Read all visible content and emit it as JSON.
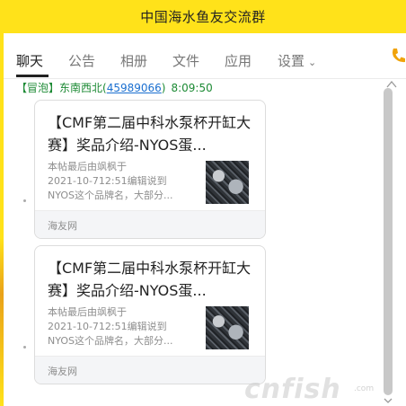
{
  "window": {
    "title": "中国海水鱼友交流群"
  },
  "tabs": [
    {
      "label": "聊天",
      "active": true
    },
    {
      "label": "公告",
      "active": false
    },
    {
      "label": "相册",
      "active": false
    },
    {
      "label": "文件",
      "active": false
    },
    {
      "label": "应用",
      "active": false
    },
    {
      "label": "设置",
      "active": false
    }
  ],
  "colors": {
    "title_bar": "#ffe21a",
    "sender": "#1c8a34",
    "qq_link": "#1a6fd0"
  },
  "message": {
    "tag": "【冒泡】",
    "sender": "东南西北",
    "qq_open": "(",
    "qq": "45989066",
    "qq_close": ")",
    "time": "8:09:50"
  },
  "cards": [
    {
      "title": "【CMF第二届中科水泵杯开缸大赛】奖品介绍-NYOS蛋...",
      "desc_line1": "本帖最后由飒枫于",
      "desc_line2": "2021-10-712:51编辑说到",
      "desc_line3": "NYOS这个品牌名，大部分...",
      "source": "海友网"
    },
    {
      "title": "【CMF第二届中科水泵杯开缸大赛】奖品介绍-NYOS蛋...",
      "desc_line1": "本帖最后由飒枫于",
      "desc_line2": "2021-10-712:51编辑说到",
      "desc_line3": "NYOS这个品牌名，大部分...",
      "source": "海友网"
    }
  ],
  "watermark": {
    "main": "cnfish",
    "sub": ".com"
  },
  "icons": [
    "phone-icon",
    "chevron-down-icon",
    "collapse-up-icon",
    "scroll-down-icon"
  ]
}
